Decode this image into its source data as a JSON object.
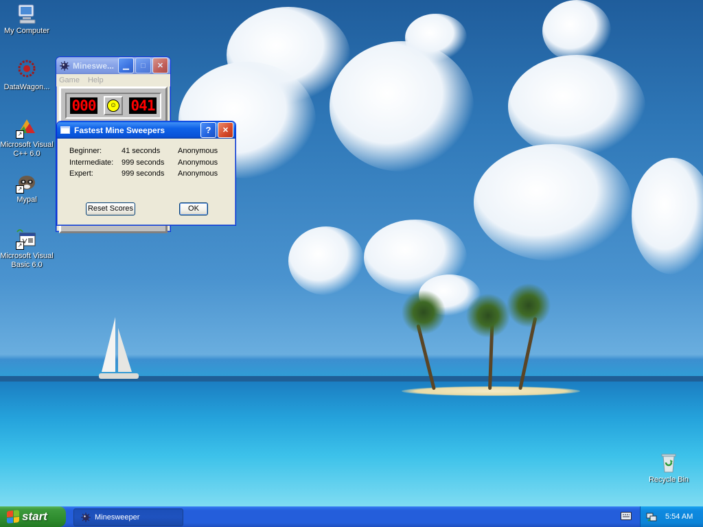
{
  "desktop": {
    "icons": [
      {
        "label": "My Computer"
      },
      {
        "label": "DataWagon..."
      },
      {
        "label": "Microsoft Visual C++ 6.0"
      },
      {
        "label": "Mypal"
      },
      {
        "label": "Microsoft Visual Basic 6.0"
      },
      {
        "label": "Recycle Bin"
      }
    ]
  },
  "minesweeper": {
    "title": "Minesweeper",
    "title_display": "Mineswe...",
    "menu": {
      "game": "Game",
      "help": "Help"
    },
    "mines_counter": "000",
    "timer": "041"
  },
  "dialog": {
    "title": "Fastest Mine Sweepers",
    "help_label": "?",
    "close_label": "X",
    "scores": [
      {
        "level": "Beginner:",
        "time": "41 seconds",
        "name": "Anonymous"
      },
      {
        "level": "Intermediate:",
        "time": "999 seconds",
        "name": "Anonymous"
      },
      {
        "level": "Expert:",
        "time": "999 seconds",
        "name": "Anonymous"
      }
    ],
    "reset_label": "Reset Scores",
    "ok_label": "OK"
  },
  "taskbar": {
    "start_label": "start",
    "task_label": "Minesweeper",
    "clock": "5:54 AM"
  },
  "colors": {
    "xp_blue": "#0a5de7",
    "start_green": "#3c9a3c",
    "tray_blue": "#0f8ae0",
    "lcd_red": "#ff0000"
  }
}
